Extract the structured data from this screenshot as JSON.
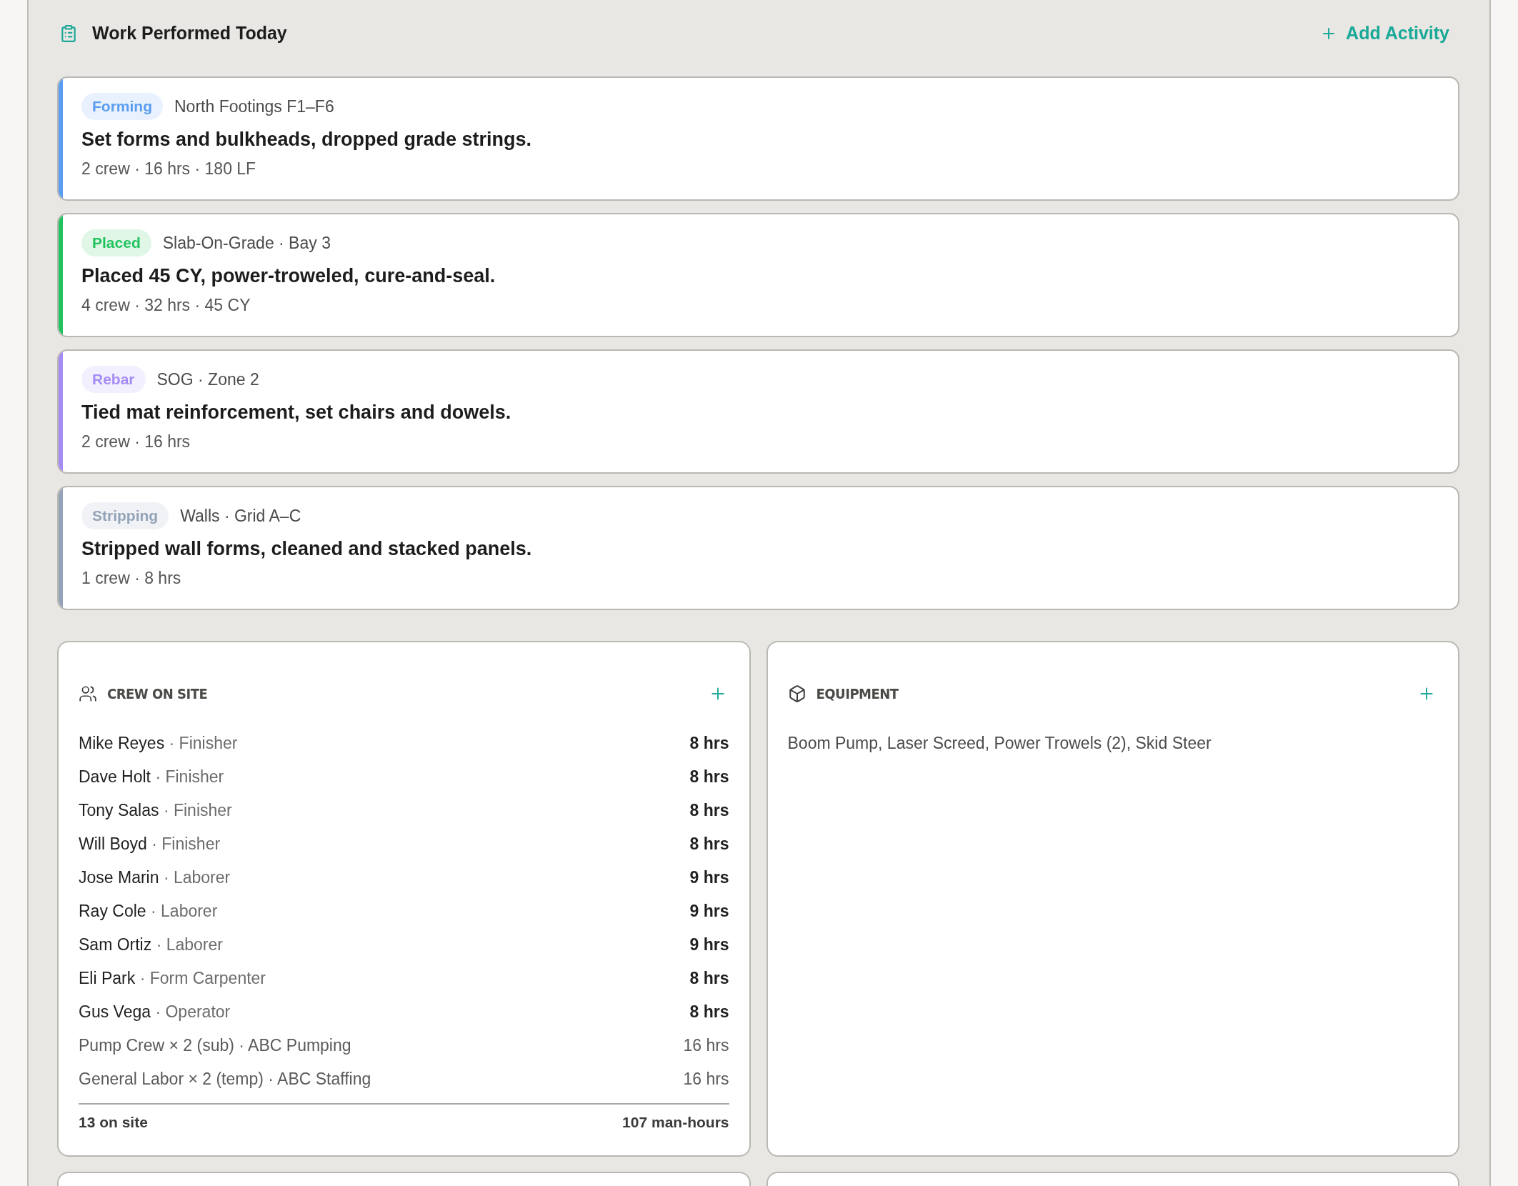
{
  "section": {
    "title": "Work Performed Today",
    "add_label": "Add Activity"
  },
  "activities": [
    {
      "tag": "Forming",
      "color": "#5b9df0",
      "location": "North Footings F1–F6",
      "description": "Set forms and bulkheads, dropped grade strings.",
      "meta": "2 crew · 16 hrs · 180 LF"
    },
    {
      "tag": "Placed",
      "color": "#22c35e",
      "location": "Slab-On-Grade · Bay 3",
      "description": "Placed 45 CY, power-troweled, cure-and-seal.",
      "meta": "4 crew · 32 hrs · 45 CY"
    },
    {
      "tag": "Rebar",
      "color": "#a58cf5",
      "location": "SOG · Zone 2",
      "description": "Tied mat reinforcement, set chairs and dowels.",
      "meta": "2 crew · 16 hrs"
    },
    {
      "tag": "Stripping",
      "color": "#94a3b8",
      "location": "Walls · Grid A–C",
      "description": "Stripped wall forms, cleaned and stacked panels.",
      "meta": "1 crew · 8 hrs"
    }
  ],
  "crew": {
    "title": "CREW ON SITE",
    "members": [
      {
        "kind": "staff",
        "name": "Mike Reyes",
        "role": "· Finisher",
        "hours": "8 hrs"
      },
      {
        "kind": "staff",
        "name": "Dave Holt",
        "role": "· Finisher",
        "hours": "8 hrs"
      },
      {
        "kind": "staff",
        "name": "Tony Salas",
        "role": "· Finisher",
        "hours": "8 hrs"
      },
      {
        "kind": "staff",
        "name": "Will Boyd",
        "role": "· Finisher",
        "hours": "8 hrs"
      },
      {
        "kind": "staff",
        "name": "Jose Marin",
        "role": "· Laborer",
        "hours": "9 hrs"
      },
      {
        "kind": "staff",
        "name": "Ray Cole",
        "role": "· Laborer",
        "hours": "9 hrs"
      },
      {
        "kind": "staff",
        "name": "Sam Ortiz",
        "role": "· Laborer",
        "hours": "9 hrs"
      },
      {
        "kind": "staff",
        "name": "Eli Park",
        "role": "· Form Carpenter",
        "hours": "8 hrs"
      },
      {
        "kind": "staff",
        "name": "Gus Vega",
        "role": "· Operator",
        "hours": "8 hrs"
      },
      {
        "kind": "sub",
        "name": "Pump Crew × 2 (sub) · ABC Pumping",
        "hours": "16 hrs"
      },
      {
        "kind": "sub",
        "name": "General Labor × 2 (temp) · ABC Staffing",
        "hours": "16 hrs"
      }
    ],
    "total_count": "13 on site",
    "total_hours": "107 man-hours"
  },
  "equipment": {
    "title": "EQUIPMENT",
    "items": "Boom Pump, Laser Screed, Power Trowels (2), Skid Steer"
  }
}
